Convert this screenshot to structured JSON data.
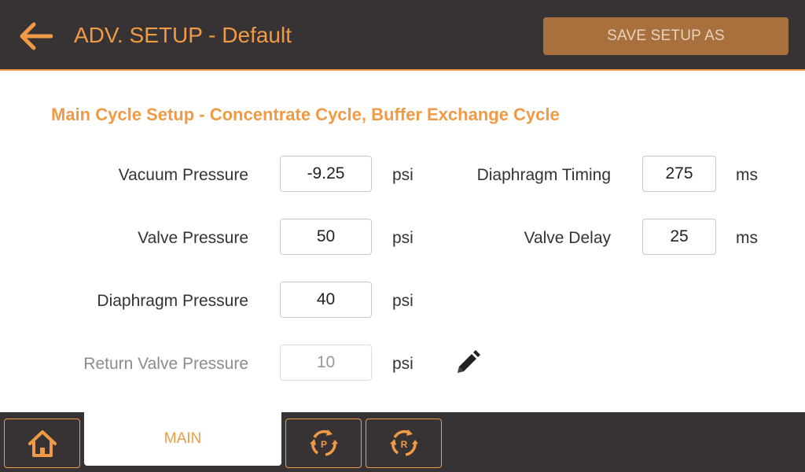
{
  "header": {
    "title": "ADV. SETUP - Default",
    "save_label": "SAVE SETUP AS",
    "back_icon": "back-arrow-icon"
  },
  "section": {
    "title": "Main Cycle Setup - Concentrate Cycle, Buffer Exchange Cycle"
  },
  "left_params": [
    {
      "label": "Vacuum Pressure",
      "value": "-9.25",
      "unit": "psi"
    },
    {
      "label": "Valve Pressure",
      "value": "50",
      "unit": "psi"
    },
    {
      "label": "Diaphragm Pressure",
      "value": "40",
      "unit": "psi"
    },
    {
      "label": "Return Valve Pressure",
      "value": "10",
      "unit": "psi"
    }
  ],
  "right_params": [
    {
      "label": "Diaphragm Timing",
      "value": "275",
      "unit": "ms"
    },
    {
      "label": "Valve Delay",
      "value": "25",
      "unit": "ms"
    }
  ],
  "footer": {
    "main_tab_label": "MAIN",
    "cycle_p_letter": "P",
    "cycle_r_letter": "R"
  },
  "colors": {
    "accent": "#f09a45",
    "header_bg": "#373334",
    "save_button_bg": "#a8703d"
  }
}
